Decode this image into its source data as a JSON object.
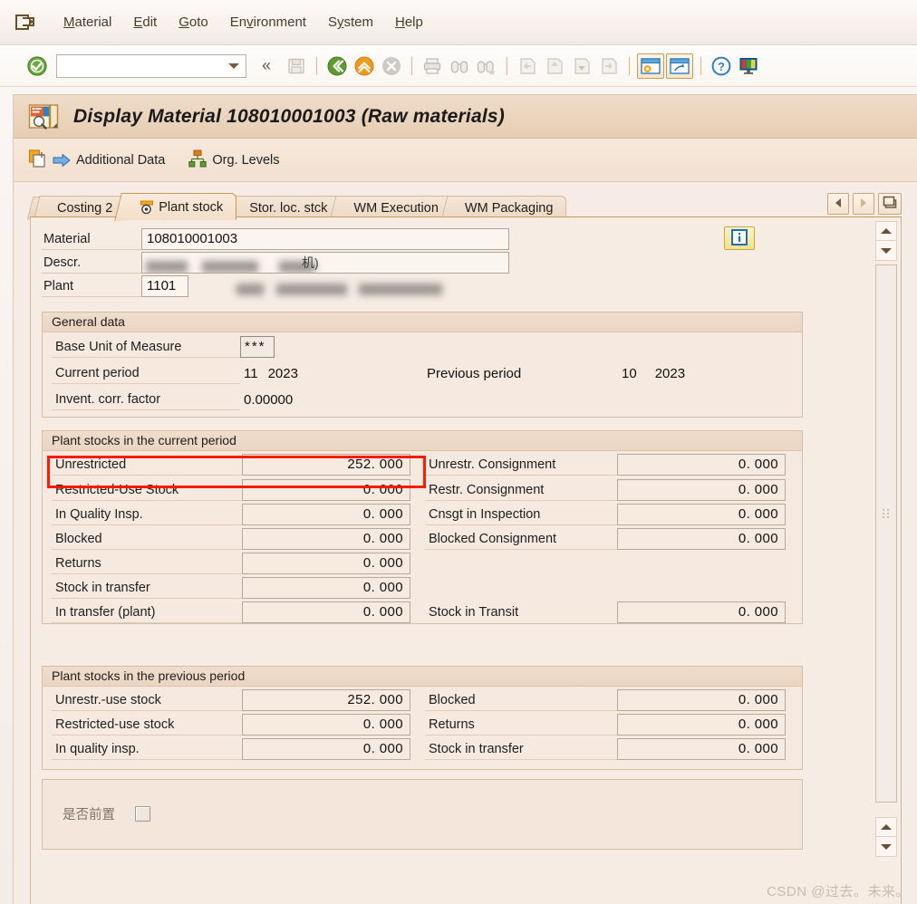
{
  "menu": {
    "exit_icon": "exit-icon",
    "items": [
      {
        "pre": "M",
        "key": "a",
        "post": "terial",
        "label": "Material"
      },
      {
        "pre": "",
        "key": "E",
        "post": "dit",
        "label": "Edit"
      },
      {
        "pre": "",
        "key": "G",
        "post": "oto",
        "label": "Goto"
      },
      {
        "pre": "En",
        "key": "v",
        "post": "ironment",
        "label": "Environment"
      },
      {
        "pre": "S",
        "key": "y",
        "post": "stem",
        "label": "System"
      },
      {
        "pre": "",
        "key": "H",
        "post": "elp",
        "label": "Help"
      }
    ]
  },
  "toolbar": {
    "enter_icon": "enter-check-icon",
    "command_value": "",
    "command_placeholder": "",
    "dropdown_icon": "chevron-down-icon",
    "collapse_icon": "double-chevron-left-icon",
    "icons": [
      "save-icon",
      "back-icon",
      "exit-icon",
      "cancel-icon",
      "print-icon",
      "find-icon",
      "find-next-icon",
      "first-page-icon",
      "previous-page-icon",
      "next-page-icon",
      "last-page-icon",
      "create-session-icon",
      "create-shortcut-icon",
      "help-icon",
      "customize-local-layout-icon"
    ]
  },
  "window": {
    "title": "Display Material 108010001003 (Raw materials)",
    "title_icon": "material-display-icon"
  },
  "appbar": {
    "buttons": [
      {
        "icon": "additional-data-icon",
        "arrow": "arrow-right-icon",
        "label": "Additional Data"
      },
      {
        "icon": "org-levels-icon",
        "label": "Org. Levels"
      }
    ]
  },
  "tabs": {
    "items": [
      {
        "label": "Costing 2",
        "active": false,
        "icon": null
      },
      {
        "label": "Plant stock",
        "active": true,
        "icon": "plant-stock-icon"
      },
      {
        "label": "Stor. loc. stck",
        "active": false,
        "icon": null
      },
      {
        "label": "WM Execution",
        "active": false,
        "icon": null
      },
      {
        "label": "WM Packaging",
        "active": false,
        "icon": null
      }
    ],
    "nav": [
      {
        "name": "tab-scroll-left-button",
        "icon": "triangle-left-icon"
      },
      {
        "name": "tab-scroll-right-button",
        "icon": "triangle-right-icon"
      },
      {
        "name": "tab-list-button",
        "icon": "tab-list-icon"
      }
    ]
  },
  "header_fields": {
    "material": {
      "label": "Material",
      "value": "108010001003"
    },
    "descr": {
      "label": "Descr.",
      "value": "",
      "redacted": true,
      "visible_tail": "机)"
    },
    "plant": {
      "label": "Plant",
      "value": "1101",
      "desc_redacted": true
    },
    "info_button_icon": "info-icon"
  },
  "general_data": {
    "legend": "General data",
    "base_unit_label": "Base Unit of Measure",
    "base_unit_value": "***",
    "current_period_label": "Current period",
    "current_period_month": "11",
    "current_period_year": "2023",
    "previous_period_label": "Previous period",
    "previous_period_month": "10",
    "previous_period_year": "2023",
    "invent_corr_label": "Invent. corr. factor",
    "invent_corr_value": "0.00000"
  },
  "current_period": {
    "legend": "Plant stocks in the current period",
    "left": [
      {
        "label": "Unrestricted",
        "value": "252. 000",
        "highlighted": true
      },
      {
        "label": "Restricted-Use Stock",
        "value": "0. 000",
        "highlighted": false
      },
      {
        "label": "In Quality Insp.",
        "value": "0. 000",
        "highlighted": false
      },
      {
        "label": "Blocked",
        "value": "0. 000",
        "highlighted": false
      },
      {
        "label": "Returns",
        "value": "0. 000",
        "highlighted": false
      },
      {
        "label": "Stock in transfer",
        "value": "0. 000",
        "highlighted": false
      },
      {
        "label": "In transfer (plant)",
        "value": "0. 000",
        "highlighted": false
      }
    ],
    "right": [
      {
        "label": "Unrestr. Consignment",
        "value": "0. 000",
        "row": 0
      },
      {
        "label": "Restr. Consignment",
        "value": "0. 000",
        "row": 1
      },
      {
        "label": "Cnsgt in Inspection",
        "value": "0. 000",
        "row": 2
      },
      {
        "label": "Blocked Consignment",
        "value": "0. 000",
        "row": 3
      },
      {
        "label": "Stock in Transit",
        "value": "0. 000",
        "row": 6
      }
    ]
  },
  "previous_period": {
    "legend": "Plant stocks in the previous period",
    "left": [
      {
        "label": "Unrestr.-use stock",
        "value": "252. 000"
      },
      {
        "label": "Restricted-use stock",
        "value": "0. 000"
      },
      {
        "label": "In quality insp.",
        "value": "0. 000"
      }
    ],
    "right": [
      {
        "label": "Blocked",
        "value": "0. 000"
      },
      {
        "label": "Returns",
        "value": "0. 000"
      },
      {
        "label": "Stock in transfer",
        "value": "0. 000"
      }
    ]
  },
  "custom_section": {
    "checkbox_label": "是否前置",
    "checkbox_checked": false
  },
  "scrollbars": {
    "up_icon": "arrow-up-icon",
    "down_icon": "arrow-down-icon",
    "grip_icon": "scroll-grip-icon"
  },
  "watermark": "CSDN @过去。未来。",
  "colors": {
    "highlight": "#ff1a00",
    "tab_active_border": "#c79a56",
    "panel_bg": "#f6ece4",
    "title_bg": "#e6cdb4"
  }
}
